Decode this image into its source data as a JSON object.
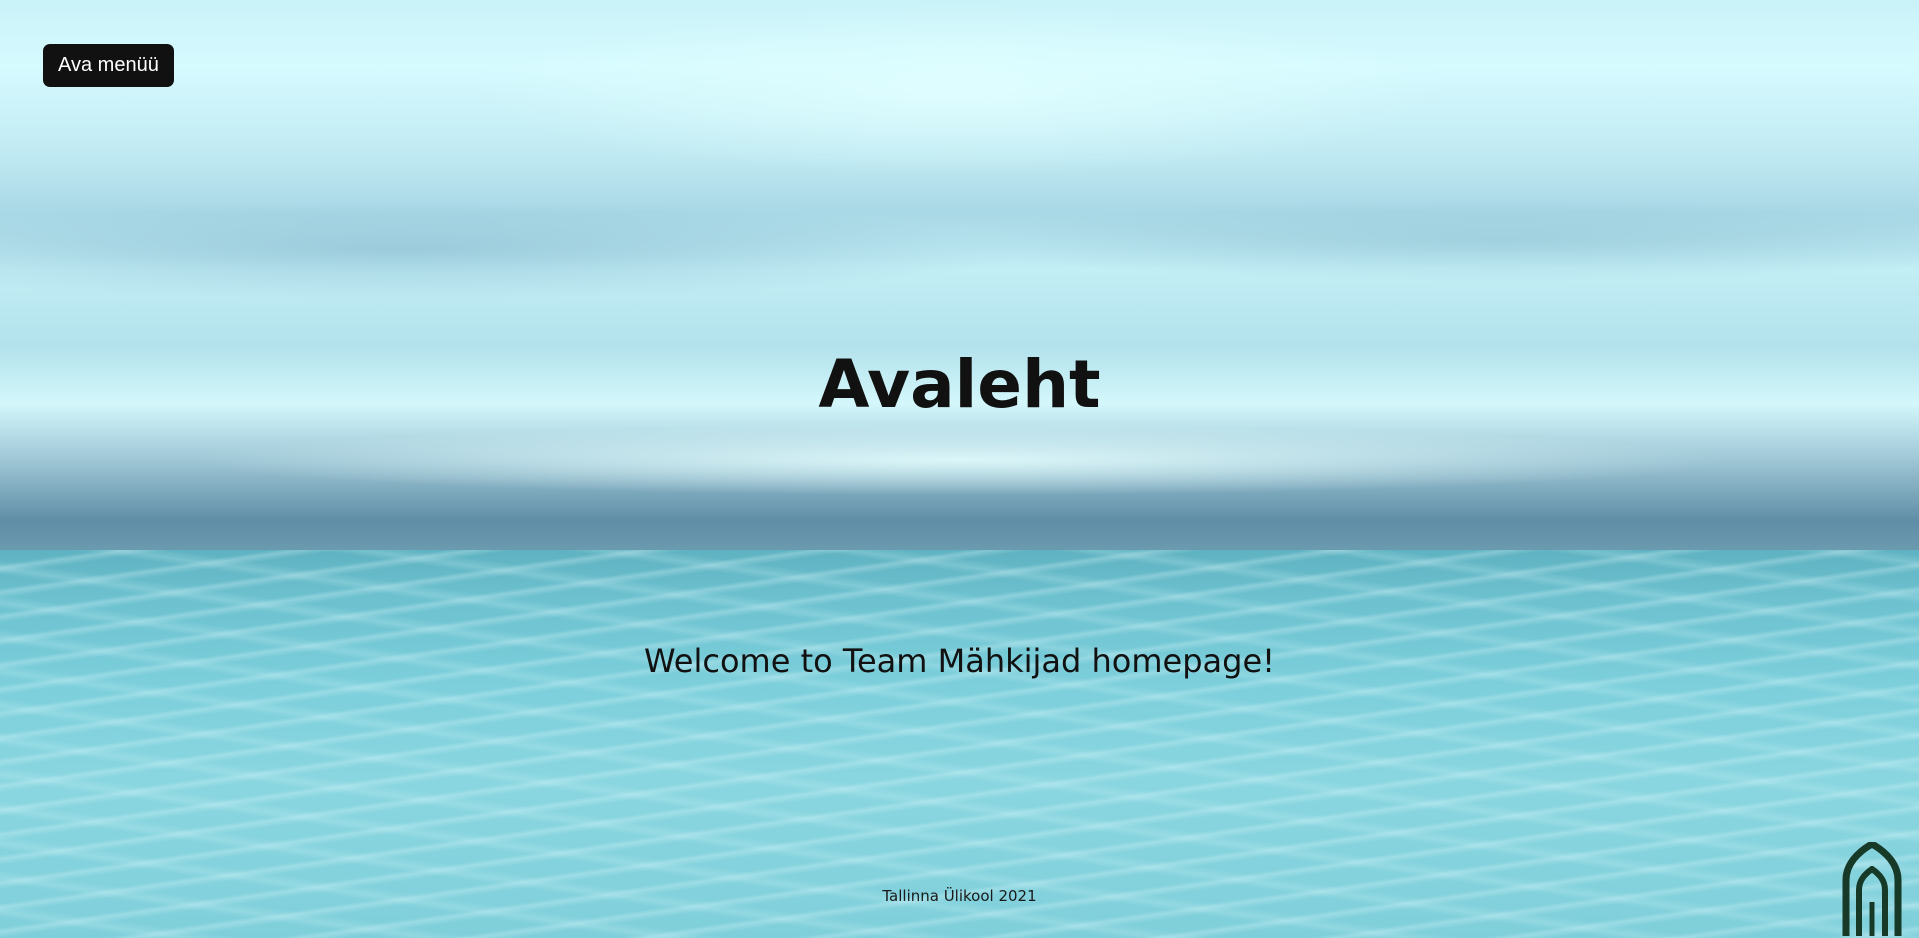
{
  "header": {
    "menu_button_label": "Ava menüü"
  },
  "main": {
    "title": "Avaleht",
    "welcome": "Welcome to Team Mähkijad homepage!"
  },
  "footer": {
    "text": "Tallinna Ülikool 2021",
    "logo_icon": "tallinn-university-arch-logo-icon"
  },
  "colors": {
    "button_background": "#111111",
    "button_text": "#ffffff",
    "text": "#111111",
    "logo": "#173a28",
    "sky": "#c9f2f8",
    "sea": "#7ccfdb"
  }
}
